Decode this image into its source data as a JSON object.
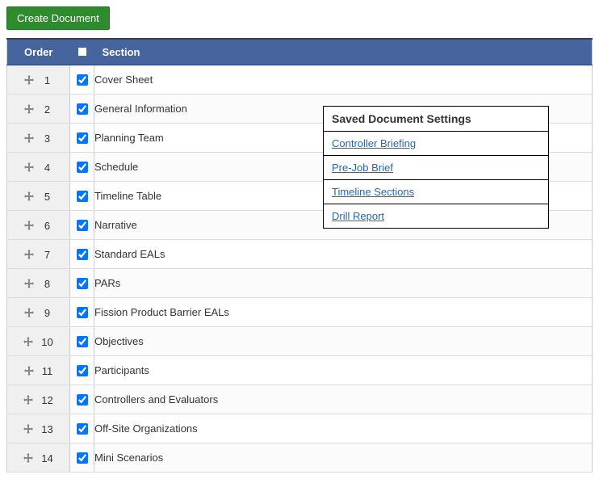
{
  "create_button_label": "Create Document",
  "columns": {
    "order": "Order",
    "section": "Section"
  },
  "rows": [
    {
      "order": "1",
      "checked": true,
      "section": "Cover Sheet"
    },
    {
      "order": "2",
      "checked": true,
      "section": "General Information"
    },
    {
      "order": "3",
      "checked": true,
      "section": "Planning Team"
    },
    {
      "order": "4",
      "checked": true,
      "section": "Schedule"
    },
    {
      "order": "5",
      "checked": true,
      "section": "Timeline Table"
    },
    {
      "order": "6",
      "checked": true,
      "section": "Narrative"
    },
    {
      "order": "7",
      "checked": true,
      "section": "Standard EALs"
    },
    {
      "order": "8",
      "checked": true,
      "section": "PARs"
    },
    {
      "order": "9",
      "checked": true,
      "section": "Fission Product Barrier EALs"
    },
    {
      "order": "10",
      "checked": true,
      "section": "Objectives"
    },
    {
      "order": "11",
      "checked": true,
      "section": "Participants"
    },
    {
      "order": "12",
      "checked": true,
      "section": "Controllers and Evaluators"
    },
    {
      "order": "13",
      "checked": true,
      "section": "Off-Site Organizations"
    },
    {
      "order": "14",
      "checked": true,
      "section": "Mini Scenarios"
    }
  ],
  "popup": {
    "title": "Saved Document Settings",
    "items": [
      "Controller Briefing",
      "Pre-Job Brief",
      "Timeline Sections",
      "Drill Report"
    ]
  }
}
